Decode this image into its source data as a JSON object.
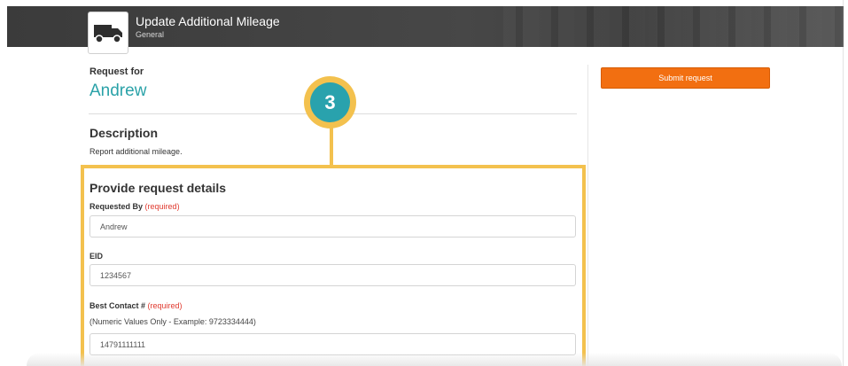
{
  "header": {
    "title": "Update Additional Mileage",
    "subtitle": "General",
    "icon": "truck-icon"
  },
  "request": {
    "label": "Request for",
    "name": "Andrew"
  },
  "description": {
    "heading": "Description",
    "text": "Report additional mileage."
  },
  "actions": {
    "submit_label": "Submit request"
  },
  "callout": {
    "step": "3"
  },
  "details": {
    "heading": "Provide request details",
    "fields": [
      {
        "label": "Requested By",
        "required": "(required)",
        "value": "Andrew"
      },
      {
        "label": "EID",
        "required": "",
        "value": "1234567"
      },
      {
        "label": "Best Contact #",
        "required": "(required)",
        "hint": "(Numeric Values Only - Example: 9723334444)",
        "value": "14791111111"
      }
    ]
  },
  "colors": {
    "accent_teal": "#2aa2a8",
    "submit_orange": "#f26f11",
    "callout_yellow": "#f3c14e",
    "required_red": "#e03a2f"
  }
}
